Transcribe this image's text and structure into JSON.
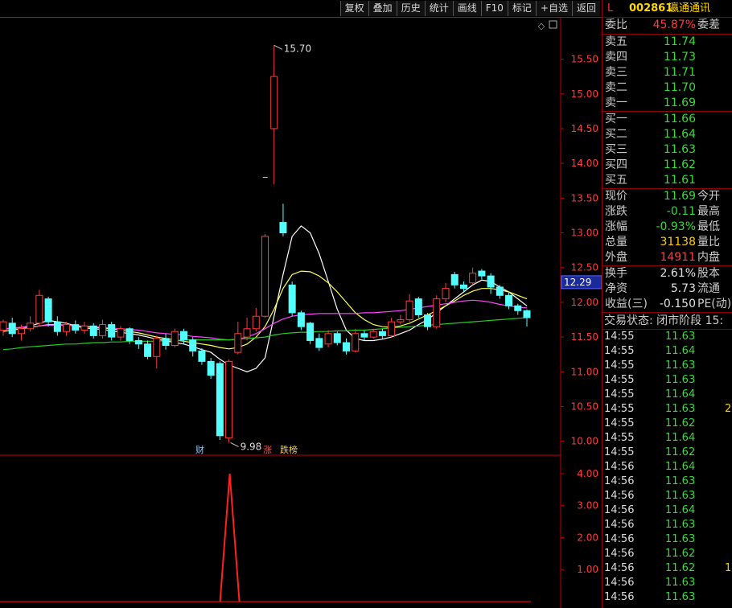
{
  "toolbar": {
    "buttons": [
      "复权",
      "叠加",
      "历史",
      "统计",
      "画线",
      "F10",
      "标记",
      "+自选",
      "返回"
    ]
  },
  "chart_data": {
    "type": "candlestick",
    "ylim": [
      9.8,
      15.9
    ],
    "yticks": [
      "15.50",
      "15.00",
      "14.50",
      "14.00",
      "13.50",
      "13.00",
      "12.50",
      "12.00",
      "11.50",
      "11.00",
      "10.50",
      "10.00"
    ],
    "current_price_label": "12.29",
    "high_annotation": "15.70",
    "low_annotation": "9.98",
    "markers": [
      "财",
      "涨",
      "跌榜"
    ],
    "candles": [
      [
        11.6,
        11.72,
        11.75,
        11.52
      ],
      [
        11.7,
        11.55,
        11.78,
        11.5
      ],
      [
        11.55,
        11.62,
        11.68,
        11.45
      ],
      [
        11.62,
        11.7,
        11.8,
        11.58
      ],
      [
        11.7,
        12.1,
        12.18,
        11.65
      ],
      [
        12.05,
        11.72,
        12.08,
        11.65
      ],
      [
        11.72,
        11.58,
        11.8,
        11.52
      ],
      [
        11.58,
        11.68,
        11.72,
        11.52
      ],
      [
        11.68,
        11.6,
        11.74,
        11.55
      ],
      [
        11.6,
        11.66,
        11.72,
        11.55
      ],
      [
        11.66,
        11.52,
        11.7,
        11.48
      ],
      [
        11.52,
        11.68,
        11.75,
        11.48
      ],
      [
        11.68,
        11.5,
        11.72,
        11.45
      ],
      [
        11.5,
        11.62,
        11.66,
        11.45
      ],
      [
        11.62,
        11.45,
        11.64,
        11.4
      ],
      [
        11.45,
        11.4,
        11.5,
        11.33
      ],
      [
        11.4,
        11.22,
        11.45,
        11.18
      ],
      [
        11.22,
        11.48,
        11.52,
        11.05
      ],
      [
        11.48,
        11.38,
        11.55,
        11.32
      ],
      [
        11.38,
        11.58,
        11.62,
        11.35
      ],
      [
        11.58,
        11.46,
        11.62,
        11.4
      ],
      [
        11.46,
        11.3,
        11.5,
        11.22
      ],
      [
        11.3,
        11.15,
        11.34,
        11.1
      ],
      [
        11.15,
        10.95,
        11.2,
        10.9
      ],
      [
        11.12,
        10.08,
        11.15,
        10.02
      ],
      [
        10.05,
        11.15,
        11.18,
        9.98
      ],
      [
        11.28,
        11.55,
        11.72,
        11.25
      ],
      [
        11.5,
        11.62,
        11.78,
        11.45
      ],
      [
        11.62,
        11.8,
        11.92,
        11.58
      ],
      [
        11.8,
        12.95,
        12.98,
        11.78
      ],
      [
        14.5,
        15.25,
        15.7,
        13.7
      ],
      [
        13.15,
        13.0,
        13.42,
        12.95
      ],
      [
        12.25,
        11.85,
        12.3,
        11.8
      ],
      [
        11.85,
        11.65,
        11.88,
        11.6
      ],
      [
        11.7,
        11.45,
        11.72,
        11.4
      ],
      [
        11.48,
        11.35,
        11.55,
        11.3
      ],
      [
        11.4,
        11.55,
        11.6,
        11.35
      ],
      [
        11.55,
        11.42,
        11.58,
        11.38
      ],
      [
        11.42,
        11.3,
        11.48,
        11.25
      ],
      [
        11.3,
        11.55,
        11.62,
        11.28
      ],
      [
        11.55,
        11.5,
        11.6,
        11.45
      ],
      [
        11.5,
        11.58,
        11.62,
        11.48
      ],
      [
        11.58,
        11.52,
        11.62,
        11.48
      ],
      [
        11.52,
        11.72,
        11.78,
        11.5
      ],
      [
        11.72,
        11.75,
        11.82,
        11.68
      ],
      [
        11.75,
        12.02,
        12.12,
        11.72
      ],
      [
        12.05,
        11.82,
        12.08,
        11.78
      ],
      [
        11.82,
        11.65,
        11.85,
        11.6
      ],
      [
        11.65,
        12.05,
        12.1,
        11.62
      ],
      [
        12.05,
        12.2,
        12.28,
        12.0
      ],
      [
        12.4,
        12.25,
        12.44,
        12.2
      ],
      [
        12.25,
        12.2,
        12.3,
        12.15
      ],
      [
        12.28,
        12.42,
        12.5,
        12.25
      ],
      [
        12.45,
        12.38,
        12.48,
        12.33
      ],
      [
        12.38,
        12.22,
        12.42,
        12.12
      ],
      [
        12.22,
        12.1,
        12.25,
        12.05
      ],
      [
        12.1,
        11.95,
        12.15,
        11.9
      ],
      [
        11.95,
        11.88,
        11.98,
        11.82
      ],
      [
        11.88,
        11.78,
        11.9,
        11.65
      ]
    ],
    "ma_lines": [
      {
        "color": "#ffffff",
        "values": [
          11.62,
          11.62,
          11.64,
          11.66,
          11.7,
          11.74,
          11.72,
          11.7,
          11.66,
          11.63,
          11.62,
          11.61,
          11.59,
          11.57,
          11.55,
          11.53,
          11.5,
          11.47,
          11.45,
          11.42,
          11.4,
          11.36,
          11.32,
          11.28,
          11.18,
          11.1,
          11.05,
          11.0,
          11.05,
          11.2,
          11.8,
          12.4,
          12.95,
          13.1,
          13.0,
          12.7,
          12.3,
          11.9,
          11.6,
          11.48,
          11.45,
          11.45,
          11.47,
          11.5,
          11.55,
          11.6,
          11.68,
          11.75,
          11.85,
          11.95,
          12.05,
          12.15,
          12.25,
          12.32,
          12.3,
          12.22,
          12.15,
          12.05,
          11.95
        ]
      },
      {
        "color": "#ffff55",
        "values": [
          11.58,
          11.6,
          11.62,
          11.64,
          11.66,
          11.68,
          11.68,
          11.67,
          11.66,
          11.65,
          11.64,
          11.63,
          11.62,
          11.6,
          11.58,
          11.56,
          11.53,
          11.5,
          11.48,
          11.46,
          11.44,
          11.42,
          11.4,
          11.38,
          11.35,
          11.33,
          11.35,
          11.4,
          11.5,
          11.65,
          11.9,
          12.2,
          12.4,
          12.45,
          12.44,
          12.38,
          12.28,
          12.15,
          12.0,
          11.85,
          11.75,
          11.68,
          11.65,
          11.64,
          11.66,
          11.7,
          11.76,
          11.82,
          11.88,
          11.95,
          12.02,
          12.1,
          12.16,
          12.2,
          12.2,
          12.18,
          12.15,
          12.1,
          12.05
        ]
      },
      {
        "color": "#ff44ff",
        "values": [
          11.62,
          11.63,
          11.64,
          11.65,
          11.66,
          11.67,
          11.67,
          11.67,
          11.66,
          11.66,
          11.65,
          11.64,
          11.63,
          11.62,
          11.61,
          11.6,
          11.58,
          11.56,
          11.55,
          11.54,
          11.53,
          11.51,
          11.5,
          11.49,
          11.47,
          11.46,
          11.47,
          11.5,
          11.55,
          11.62,
          11.7,
          11.76,
          11.8,
          11.82,
          11.83,
          11.84,
          11.84,
          11.84,
          11.84,
          11.84,
          11.85,
          11.85,
          11.86,
          11.87,
          11.88,
          11.9,
          11.92,
          11.94,
          11.96,
          11.98,
          12.0,
          12.02,
          12.03,
          12.02,
          12.0,
          11.97,
          11.95,
          11.93,
          11.92
        ]
      },
      {
        "color": "#22cc22",
        "values": [
          11.32,
          11.33,
          11.35,
          11.36,
          11.37,
          11.38,
          11.39,
          11.4,
          11.4,
          11.41,
          11.42,
          11.42,
          11.43,
          11.43,
          11.44,
          11.44,
          11.44,
          11.44,
          11.45,
          11.45,
          11.46,
          11.46,
          11.46,
          11.46,
          11.46,
          11.46,
          11.47,
          11.48,
          11.49,
          11.5,
          11.53,
          11.55,
          11.56,
          11.57,
          11.57,
          11.58,
          11.58,
          11.59,
          11.59,
          11.6,
          11.6,
          11.61,
          11.62,
          11.63,
          11.64,
          11.65,
          11.66,
          11.67,
          11.68,
          11.69,
          11.7,
          11.71,
          11.72,
          11.73,
          11.74,
          11.75,
          11.76,
          11.77,
          11.78
        ]
      }
    ],
    "sub_chart": {
      "ylim": [
        0,
        4.5
      ],
      "yticks": [
        "4.00",
        "3.00",
        "2.00",
        "1.00"
      ],
      "spike_value": 4.0
    }
  },
  "panel": {
    "stock": {
      "flag": "L",
      "code": "002861",
      "name": "瀛通通讯"
    },
    "weibi": {
      "label": "委比",
      "value": "45.87%",
      "right": "委差"
    },
    "asks": [
      {
        "label": "卖五",
        "price": "11.74"
      },
      {
        "label": "卖四",
        "price": "11.73"
      },
      {
        "label": "卖三",
        "price": "11.71"
      },
      {
        "label": "卖二",
        "price": "11.70"
      },
      {
        "label": "卖一",
        "price": "11.69"
      }
    ],
    "bids": [
      {
        "label": "买一",
        "price": "11.66"
      },
      {
        "label": "买二",
        "price": "11.64"
      },
      {
        "label": "买三",
        "price": "11.63"
      },
      {
        "label": "买四",
        "price": "11.62"
      },
      {
        "label": "买五",
        "price": "11.61"
      }
    ],
    "quote": [
      {
        "label": "现价",
        "value": "11.69",
        "right": "今开",
        "cls": "green"
      },
      {
        "label": "涨跌",
        "value": "-0.11",
        "right": "最高",
        "cls": "green"
      },
      {
        "label": "涨幅",
        "value": "-0.93%",
        "right": "最低",
        "cls": "green"
      },
      {
        "label": "总量",
        "value": "31138",
        "right": "量比",
        "cls": "yellow"
      },
      {
        "label": "外盘",
        "value": "14911",
        "right": "内盘",
        "cls": "red"
      }
    ],
    "fin": [
      {
        "label": "换手",
        "value": "2.61%",
        "right": "股本"
      },
      {
        "label": "净资",
        "value": "5.73",
        "right": "流通"
      },
      {
        "label": "收益(三)",
        "value": "-0.150",
        "right": "PE(动)"
      }
    ],
    "status": "交易状态: 闭市阶段 15:",
    "ticks": [
      {
        "time": "14:55",
        "price": "11.63",
        "extra": ""
      },
      {
        "time": "14:55",
        "price": "11.64",
        "extra": ""
      },
      {
        "time": "14:55",
        "price": "11.63",
        "extra": ""
      },
      {
        "time": "14:55",
        "price": "11.63",
        "extra": ""
      },
      {
        "time": "14:55",
        "price": "11.64",
        "extra": ""
      },
      {
        "time": "14:55",
        "price": "11.63",
        "extra": "2"
      },
      {
        "time": "14:55",
        "price": "11.62",
        "extra": ""
      },
      {
        "time": "14:55",
        "price": "11.64",
        "extra": ""
      },
      {
        "time": "14:55",
        "price": "11.62",
        "extra": ""
      },
      {
        "time": "14:56",
        "price": "11.64",
        "extra": ""
      },
      {
        "time": "14:56",
        "price": "11.63",
        "extra": ""
      },
      {
        "time": "14:56",
        "price": "11.63",
        "extra": ""
      },
      {
        "time": "14:56",
        "price": "11.64",
        "extra": ""
      },
      {
        "time": "14:56",
        "price": "11.63",
        "extra": ""
      },
      {
        "time": "14:56",
        "price": "11.63",
        "extra": ""
      },
      {
        "time": "14:56",
        "price": "11.62",
        "extra": ""
      },
      {
        "time": "14:56",
        "price": "11.62",
        "extra": "1"
      },
      {
        "time": "14:56",
        "price": "11.63",
        "extra": ""
      },
      {
        "time": "14:56",
        "price": "11.63",
        "extra": ""
      }
    ]
  },
  "colors": {
    "up": "#ff3b3b",
    "down": "#54ffff",
    "axis": "#c00000",
    "grid_text": "#ff3b3b"
  }
}
